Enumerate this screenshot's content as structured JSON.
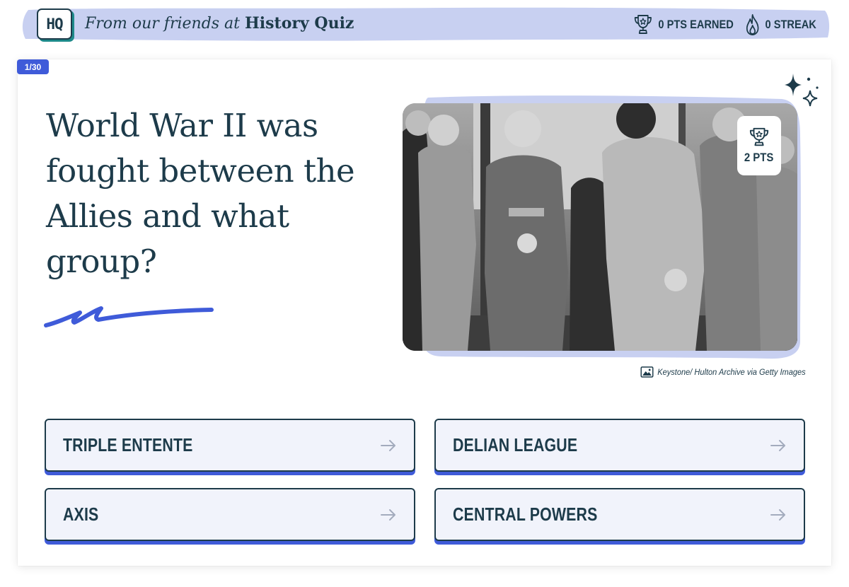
{
  "header": {
    "logo_text": "HQ",
    "lead_text": "From our friends at ",
    "brand_text": "History Quiz",
    "points_label": "0 PTS EARNED",
    "streak_label": "0 STREAK",
    "banner_color": "#c8d0f1"
  },
  "quiz": {
    "progress": "1/30",
    "question": "World War II was fought between the Allies and what group?",
    "points_badge": "2 PTS",
    "photo_credit": "Keystone/ Hulton Archive via Getty Images",
    "answers": [
      {
        "label": "TRIPLE ENTENTE"
      },
      {
        "label": "DELIAN LEAGUE"
      },
      {
        "label": "AXIS"
      },
      {
        "label": "CENTRAL POWERS"
      }
    ]
  },
  "icons": {
    "points": "trophy-icon",
    "streak": "flame-icon",
    "answer_arrow": "arrow-right-icon",
    "credit": "image-icon",
    "decoration": "sparkles-icon"
  },
  "colors": {
    "ink": "#1d3b4a",
    "accent": "#3f5bd9",
    "answer_bg": "#f1f3fb",
    "teal": "#1d8a8a"
  }
}
